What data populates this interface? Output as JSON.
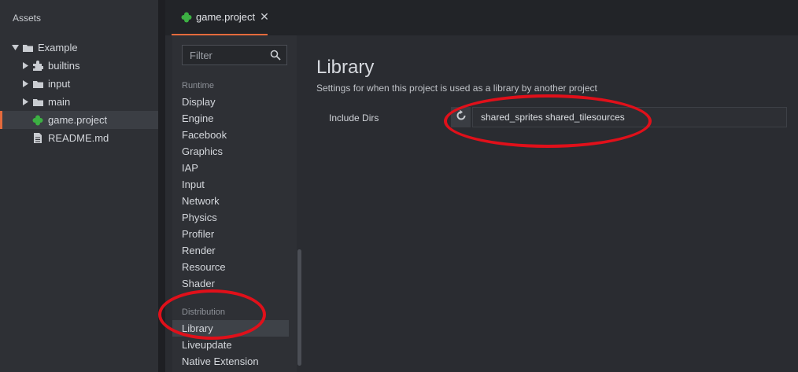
{
  "assets": {
    "header": "Assets",
    "tree": [
      {
        "label": "Example",
        "icon": "folder-icon",
        "expanded": true
      },
      {
        "label": "builtins",
        "icon": "puzzle-icon",
        "expanded": false
      },
      {
        "label": "input",
        "icon": "folder-icon",
        "expanded": false
      },
      {
        "label": "main",
        "icon": "folder-icon",
        "expanded": false
      },
      {
        "label": "game.project",
        "icon": "game-project-icon",
        "selected": true
      },
      {
        "label": "README.md",
        "icon": "file-icon"
      }
    ]
  },
  "tab": {
    "label": "game.project",
    "close": "✕"
  },
  "filter": {
    "placeholder": "Filter"
  },
  "categories": {
    "runtime_header": "Runtime",
    "runtime_items": [
      "Display",
      "Engine",
      "Facebook",
      "Graphics",
      "IAP",
      "Input",
      "Network",
      "Physics",
      "Profiler",
      "Render",
      "Resource",
      "Shader"
    ],
    "distribution_header": "Distribution",
    "distribution_items": [
      "Library",
      "Liveupdate",
      "Native Extension"
    ],
    "active": "Library"
  },
  "section": {
    "title": "Library",
    "description": "Settings for when this project is used as a library by another project",
    "field_label": "Include Dirs",
    "field_value": "shared_sprites shared_tilesources"
  },
  "colors": {
    "accent": "#e46a3c",
    "game_icon": "#3cb043",
    "annotation": "#e0101a"
  }
}
